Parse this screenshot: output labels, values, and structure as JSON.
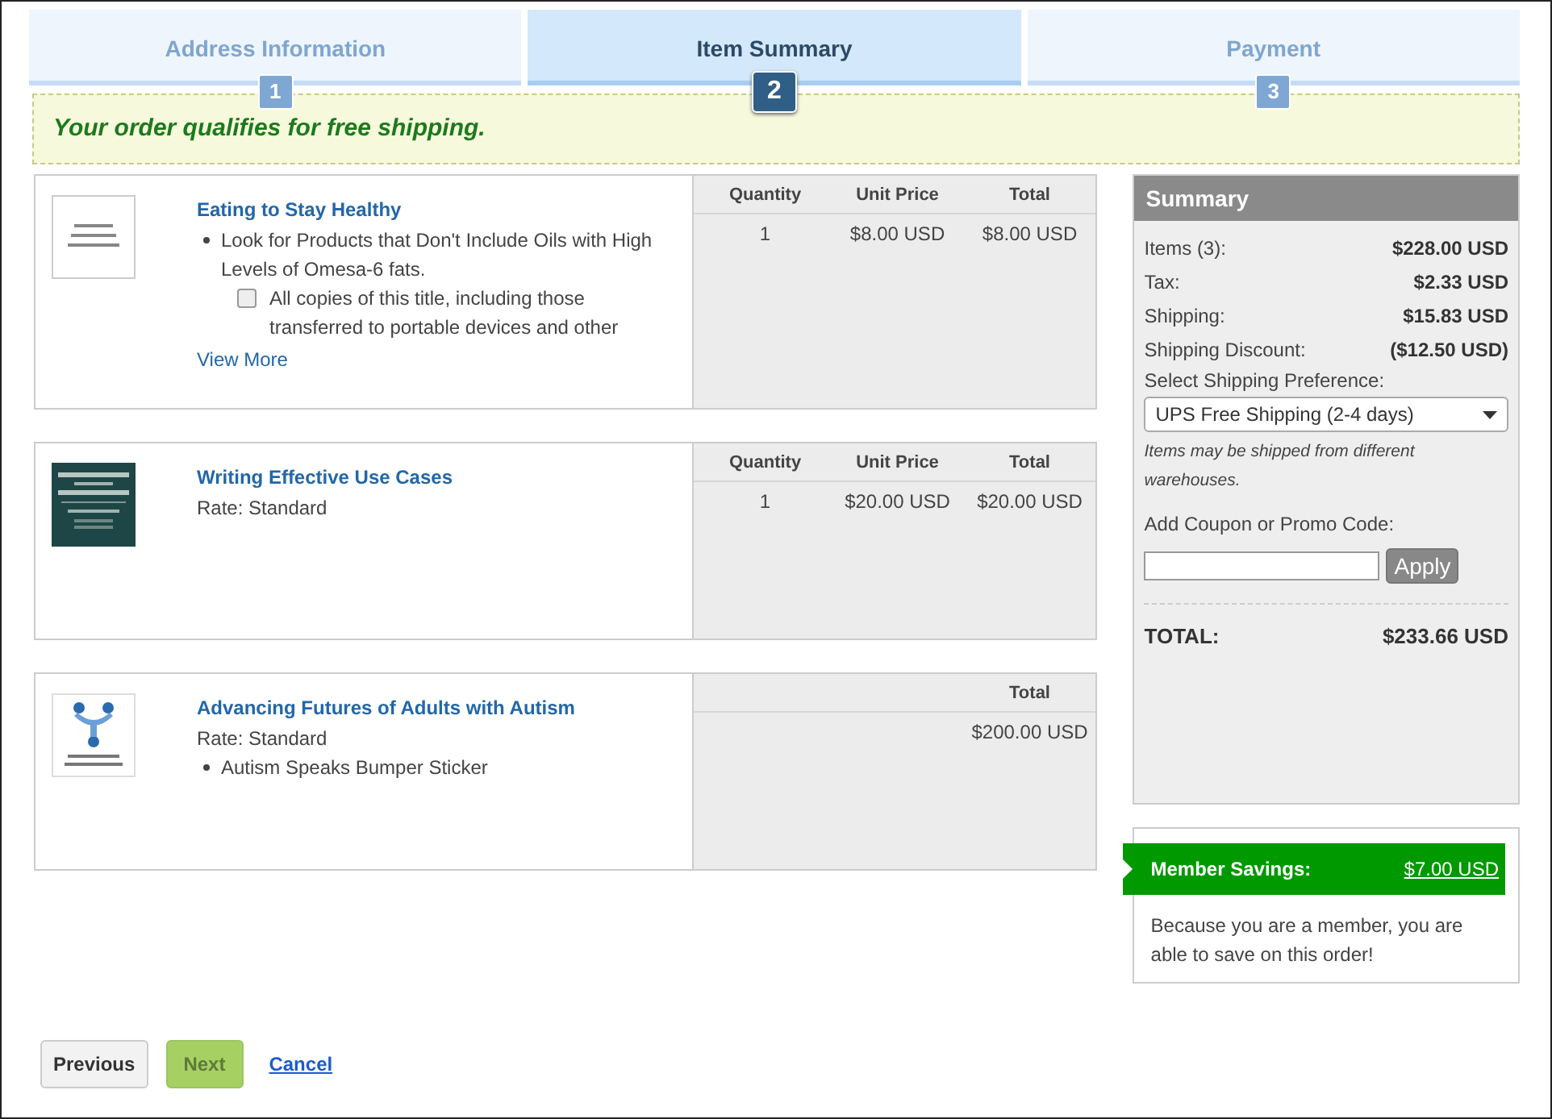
{
  "steps": [
    {
      "label": "Address Information",
      "number": "1",
      "selected": false
    },
    {
      "label": "Item Summary",
      "number": "2",
      "selected": true
    },
    {
      "label": "Payment",
      "number": "3",
      "selected": false
    }
  ],
  "banner": "Your order qualifies for free shipping.",
  "items": [
    {
      "title": "Eating to Stay Healthy",
      "lines": [
        {
          "kind": "bullet",
          "text": "Look for Products that Don't Include Oils with High Levels of Omesa-6 fats."
        },
        {
          "kind": "checkbox",
          "text": "All copies of this title, including those transferred to portable devices and other",
          "checked": false
        },
        {
          "kind": "link",
          "text": "View More"
        }
      ],
      "columns": [
        {
          "heading": "Quantity",
          "value": "1"
        },
        {
          "heading": "Unit Price",
          "value": "$8.00 USD"
        },
        {
          "heading": "Total",
          "value": "$8.00 USD"
        }
      ]
    },
    {
      "title": "Writing Effective Use Cases",
      "lines": [
        {
          "kind": "plain",
          "text": "Rate: Standard"
        }
      ],
      "columns": [
        {
          "heading": "Quantity",
          "value": "1"
        },
        {
          "heading": "Unit Price",
          "value": "$20.00 USD"
        },
        {
          "heading": "Total",
          "value": "$20.00 USD"
        }
      ]
    },
    {
      "title": "Advancing Futures of Adults with Autism",
      "lines": [
        {
          "kind": "plain",
          "text": "Rate: Standard"
        },
        {
          "kind": "bullet",
          "text": "Autism Speaks Bumper Sticker"
        }
      ],
      "columns": [
        {
          "heading": "Total",
          "value": "$200.00 USD"
        }
      ]
    }
  ],
  "summary": {
    "title": "Summary",
    "rows": [
      {
        "label": "Items (3):",
        "value": "$228.00 USD"
      },
      {
        "label": "Tax:",
        "value": "$2.33 USD"
      },
      {
        "label": "Shipping:",
        "value": "$15.83 USD"
      },
      {
        "label": "Shipping Discount:",
        "value": "($12.50 USD)"
      }
    ],
    "shipping_label": "Select Shipping Preference:",
    "shipping_value": "UPS Free Shipping (2-4 days)",
    "shipping_note": "Items may be shipped from different warehouses.",
    "coupon_label": "Add Coupon or Promo Code:",
    "apply": "Apply",
    "total_label": "TOTAL:",
    "total_value": "$233.66 USD"
  },
  "savings": {
    "label": "Member Savings:",
    "amount": "$7.00 USD",
    "text": "Because you are a member, you are able to save on this order!"
  },
  "buttons": {
    "previous": "Previous",
    "next": "Next",
    "cancel": "Cancel"
  }
}
